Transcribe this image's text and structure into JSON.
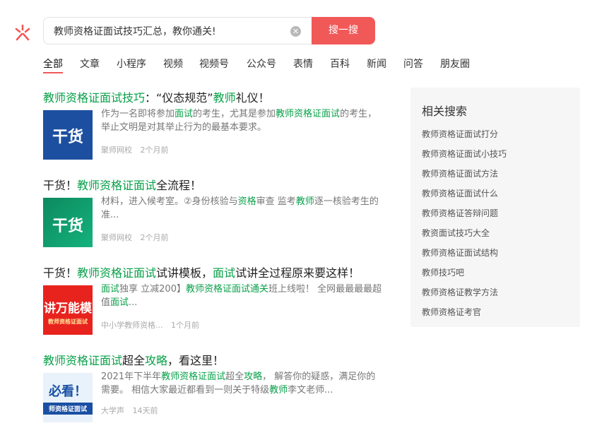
{
  "search": {
    "query": "教师资格证面试技巧汇总，教你通关!",
    "clear_icon": "✕",
    "button_label": "搜一搜"
  },
  "tabs": [
    "全部",
    "文章",
    "小程序",
    "视频",
    "视频号",
    "公众号",
    "表情",
    "百科",
    "新闻",
    "问答",
    "朋友圈"
  ],
  "results": [
    {
      "title_parts": [
        {
          "text": "教师资格证面试技巧",
          "hl": true
        },
        {
          "text": "：“仪态规范”",
          "hl": false
        },
        {
          "text": "教师",
          "hl": true
        },
        {
          "text": "礼仪！",
          "hl": false
        }
      ],
      "thumb_text": "干货",
      "desc_parts": [
        {
          "text": "作为一名即将参加",
          "hl": false
        },
        {
          "text": "面试",
          "hl": true
        },
        {
          "text": "的考生，尤其是参加",
          "hl": false
        },
        {
          "text": "教师资格证面试",
          "hl": true
        },
        {
          "text": "的考生，举止文明是对其举止行为的最基本要求。",
          "hl": false
        }
      ],
      "source": "聚师网校",
      "time": "2个月前"
    },
    {
      "title_parts": [
        {
          "text": "干货！",
          "hl": false
        },
        {
          "text": "教师资格证面试",
          "hl": true
        },
        {
          "text": "全流程！",
          "hl": false
        }
      ],
      "thumb_text": "干货",
      "desc_parts": [
        {
          "text": "材料，进入候考室。②身份核验与",
          "hl": false
        },
        {
          "text": "资格",
          "hl": true
        },
        {
          "text": "审查 监考",
          "hl": false
        },
        {
          "text": "教师",
          "hl": true
        },
        {
          "text": "逐一核验考生的准...",
          "hl": false
        }
      ],
      "source": "聚师网校",
      "time": "2个月前"
    },
    {
      "title_parts": [
        {
          "text": "干货！",
          "hl": false
        },
        {
          "text": "教师资格证面试",
          "hl": true
        },
        {
          "text": "试讲模板，",
          "hl": false
        },
        {
          "text": "面试",
          "hl": true
        },
        {
          "text": "试讲全过程原来要这样！",
          "hl": false
        }
      ],
      "thumb_text": "讲万能模",
      "thumb_sub": "教师资格证面试",
      "desc_parts": [
        {
          "text": "面试",
          "hl": true
        },
        {
          "text": "独享 立减200】",
          "hl": false
        },
        {
          "text": "教师资格证面试通关",
          "hl": true
        },
        {
          "text": "班上线啦！ 全网最最最最超值",
          "hl": false
        },
        {
          "text": "面试",
          "hl": true
        },
        {
          "text": "...",
          "hl": false
        }
      ],
      "source": "中小学教师资格...",
      "time": "1个月前"
    },
    {
      "title_parts": [
        {
          "text": "教师资格证面试",
          "hl": true
        },
        {
          "text": "超全",
          "hl": false
        },
        {
          "text": "攻略",
          "hl": true
        },
        {
          "text": "，看这里！",
          "hl": false
        }
      ],
      "thumb_text": "必看！",
      "thumb_sub": "师资格证面试",
      "desc_parts": [
        {
          "text": "2021年下半年",
          "hl": false
        },
        {
          "text": "教师资格证面试",
          "hl": true
        },
        {
          "text": "超全",
          "hl": false
        },
        {
          "text": "攻略",
          "hl": true
        },
        {
          "text": "， 解答你的疑惑，满足你的需要。 相信大家最近都看到一则关于特级",
          "hl": false
        },
        {
          "text": "教师",
          "hl": true
        },
        {
          "text": "李文老师...",
          "hl": false
        }
      ],
      "source": "大学声",
      "time": "14天前"
    }
  ],
  "related": {
    "title": "相关搜索",
    "items": [
      "教师资格证面试打分",
      "教师资格证面试小技巧",
      "教师资格证面试方法",
      "教师资格证面试什么",
      "教师资格证答辩问题",
      "教资面试技巧大全",
      "教师资格证面试结构",
      "教师技巧吧",
      "教师资格证教学方法",
      "教师资格证考官"
    ]
  },
  "colors": {
    "accent": "#f15958",
    "highlight": "#07a048"
  }
}
